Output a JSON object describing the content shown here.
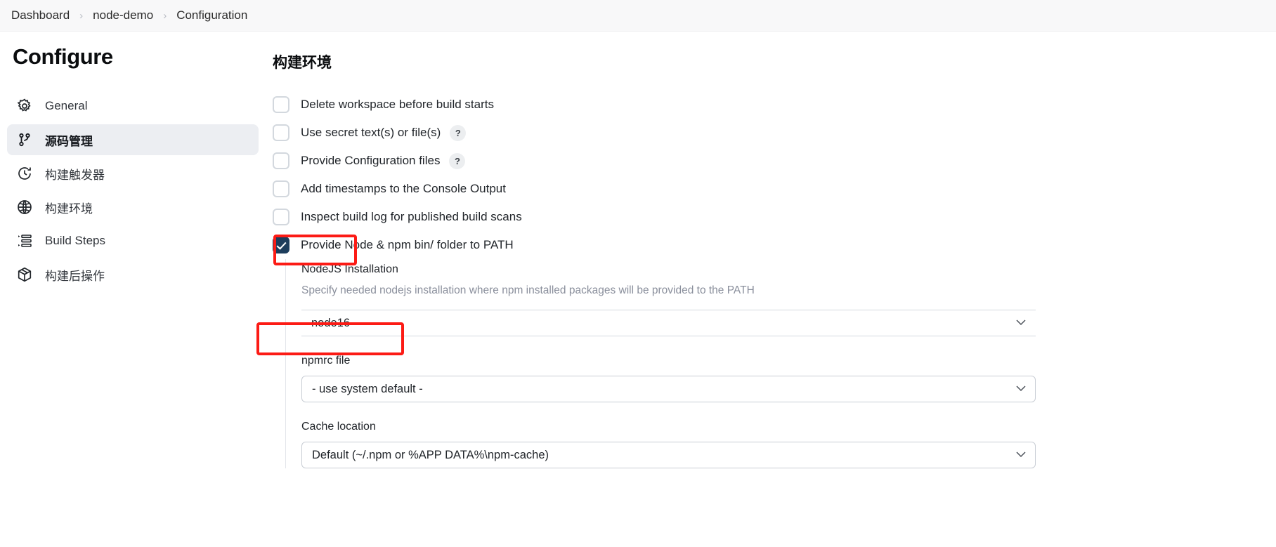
{
  "breadcrumb": {
    "items": [
      "Dashboard",
      "node-demo",
      "Configuration"
    ],
    "separator": "›"
  },
  "sidebar": {
    "title": "Configure",
    "items": [
      {
        "label": "General",
        "icon": "gear-icon",
        "active": false
      },
      {
        "label": "源码管理",
        "icon": "branch-icon",
        "active": true
      },
      {
        "label": "构建触发器",
        "icon": "clock-icon",
        "active": false
      },
      {
        "label": "构建环境",
        "icon": "globe-icon",
        "active": false
      },
      {
        "label": "Build Steps",
        "icon": "list-steps-icon",
        "active": false
      },
      {
        "label": "构建后操作",
        "icon": "package-icon",
        "active": false
      }
    ]
  },
  "main": {
    "section_title": "构建环境",
    "checkboxes": [
      {
        "label": "Delete workspace before build starts",
        "checked": false,
        "help": false
      },
      {
        "label": "Use secret text(s) or file(s)",
        "checked": false,
        "help": true
      },
      {
        "label": "Provide Configuration files",
        "checked": false,
        "help": true
      },
      {
        "label": "Add timestamps to the Console Output",
        "checked": false,
        "help": false
      },
      {
        "label": "Inspect build log for published build scans",
        "checked": false,
        "help": false
      },
      {
        "label": "Provide Node & npm bin/ folder to PATH",
        "checked": true,
        "help": false
      }
    ],
    "help_symbol": "?",
    "nodejs": {
      "label": "NodeJS Installation",
      "description": "Specify needed nodejs installation where npm installed packages will be provided to the PATH",
      "selected": "node16"
    },
    "npmrc": {
      "label": "npmrc file",
      "selected": "- use system default -"
    },
    "cache": {
      "label": "Cache location",
      "selected": "Default (~/.npm or %APP  DATA%\\npm-cache)"
    }
  },
  "annotations": {
    "accent_color": "#fc1b15",
    "checkbox_highlight": "provide-node-npm-checkbox",
    "select_highlight": "nodejs-installation-select"
  }
}
